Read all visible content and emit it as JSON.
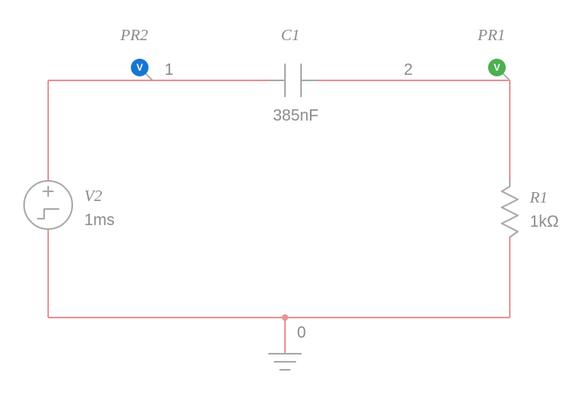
{
  "nodes": {
    "n0": "0",
    "n1": "1",
    "n2": "2"
  },
  "probes": {
    "pr1": {
      "ref": "PR1",
      "color": "#4caf50"
    },
    "pr2": {
      "ref": "PR2",
      "color": "#1776d2"
    }
  },
  "components": {
    "source": {
      "ref": "V2",
      "value": "1ms"
    },
    "cap": {
      "ref": "C1",
      "value": "385nF"
    },
    "res": {
      "ref": "R1",
      "value": "1kΩ"
    }
  }
}
